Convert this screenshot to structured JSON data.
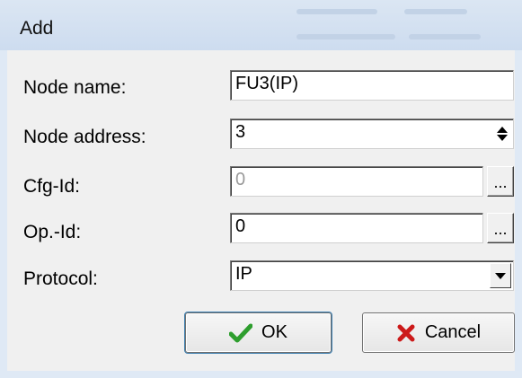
{
  "window": {
    "title": "Add"
  },
  "fields": {
    "node_name": {
      "label": "Node name:",
      "value": "FU3(IP)"
    },
    "node_address": {
      "label": "Node address:",
      "value": "3"
    },
    "cfg_id": {
      "label": "Cfg-Id:",
      "value": "0",
      "ellipsis": "..."
    },
    "op_id": {
      "label": "Op.-Id:",
      "value": "0",
      "ellipsis": "..."
    },
    "protocol": {
      "label": "Protocol:",
      "value": "IP"
    }
  },
  "buttons": {
    "ok": "OK",
    "cancel": "Cancel"
  },
  "icons": {
    "ok": "check-icon",
    "cancel": "x-icon"
  },
  "colors": {
    "ok_icon": "#2e9e2e",
    "cancel_icon": "#cc1a1a",
    "title_bar": "#d6e3f2"
  }
}
